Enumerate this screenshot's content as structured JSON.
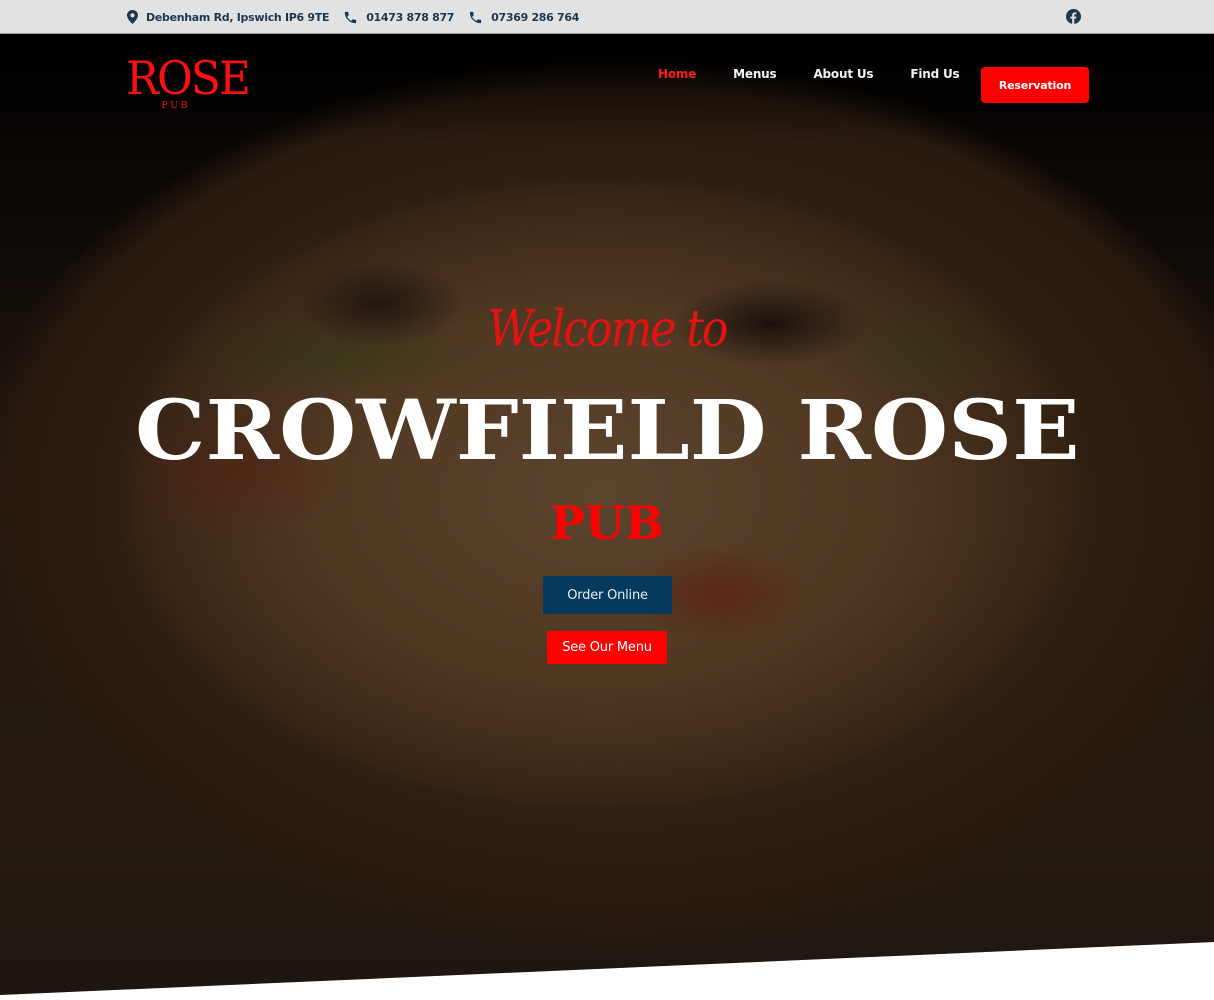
{
  "topbar": {
    "address": "Debenham Rd, Ipswich IP6 9TE",
    "phone_1": "01473 878 877",
    "phone_2": "07369 286 764",
    "social": "facebook-icon"
  },
  "logo": {
    "word": "ROSE",
    "sub": "PUB"
  },
  "nav": {
    "items": [
      {
        "label": "Home",
        "active": true
      },
      {
        "label": "Menus",
        "active": false
      },
      {
        "label": "About Us",
        "active": false
      },
      {
        "label": "Find Us",
        "active": false
      }
    ],
    "cta_label": "Reservation"
  },
  "hero": {
    "welcome": "Welcome to",
    "title": "CROWFIELD ROSE",
    "subtitle": "PUB",
    "order_label": "Order Online",
    "menu_label": "See Our Menu"
  },
  "colors": {
    "accent_red": "#ff0000",
    "navy": "#033a5e",
    "topbar_text": "#1d3750"
  }
}
